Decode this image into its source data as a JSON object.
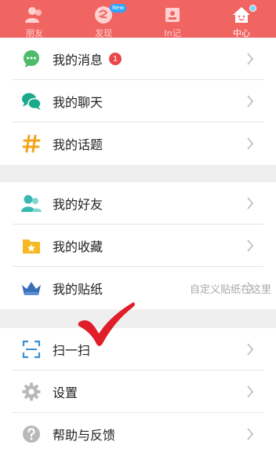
{
  "tabbar": {
    "tabs": [
      {
        "label": "朋友",
        "icon": "friends-icon"
      },
      {
        "label": "发现",
        "icon": "discover-icon",
        "badge": "New"
      },
      {
        "label": "In记",
        "icon": "in-note-icon"
      },
      {
        "label": "中心",
        "icon": "home-icon"
      }
    ],
    "active_index": 3,
    "bg_color": "#f06462"
  },
  "group1": {
    "items": [
      {
        "label": "我的消息",
        "icon": "message-icon",
        "badge": "1"
      },
      {
        "label": "我的聊天",
        "icon": "chat-icon"
      },
      {
        "label": "我的话题",
        "icon": "hashtag-icon"
      }
    ]
  },
  "group2": {
    "items": [
      {
        "label": "我的好友",
        "icon": "friend-icon"
      },
      {
        "label": "我的收藏",
        "icon": "favorite-folder-icon"
      },
      {
        "label": "我的贴纸",
        "icon": "sticker-crown-icon",
        "hint": "自定义贴纸在这里"
      }
    ]
  },
  "group3": {
    "items": [
      {
        "label": "扫一扫",
        "icon": "scan-icon"
      },
      {
        "label": "设置",
        "icon": "settings-gear-icon"
      },
      {
        "label": "帮助与反馈",
        "icon": "help-icon"
      }
    ]
  },
  "annotation": {
    "icon": "red-checkmark-icon",
    "color": "#e01e2a"
  }
}
